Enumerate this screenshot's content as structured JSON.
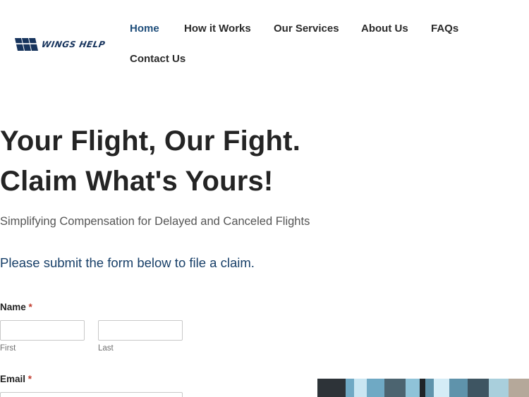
{
  "header": {
    "logo_text": "WINGS HELP",
    "nav": [
      {
        "label": "Home",
        "active": true
      },
      {
        "label": "How it Works",
        "active": false
      },
      {
        "label": "Our Services",
        "active": false
      },
      {
        "label": "About Us",
        "active": false
      },
      {
        "label": "FAQs",
        "active": false
      },
      {
        "label": "Contact Us",
        "active": false
      }
    ]
  },
  "hero": {
    "title_line1": "Your Flight, Our Fight.",
    "title_line2": "Claim What's Yours!",
    "subtitle": "Simplifying Compensation for Delayed and Canceled Flights",
    "form_intro": "Please submit the form below to file a claim."
  },
  "form": {
    "name_label": "Name",
    "required_mark": "*",
    "first_value": "",
    "first_sublabel": "First",
    "last_value": "",
    "last_sublabel": "Last",
    "email_label": "Email",
    "email_value": ""
  },
  "colors": {
    "brand": "#17345d",
    "nav_active": "#1e4d7a",
    "form_intro": "#173f68",
    "required": "#c0392b"
  }
}
